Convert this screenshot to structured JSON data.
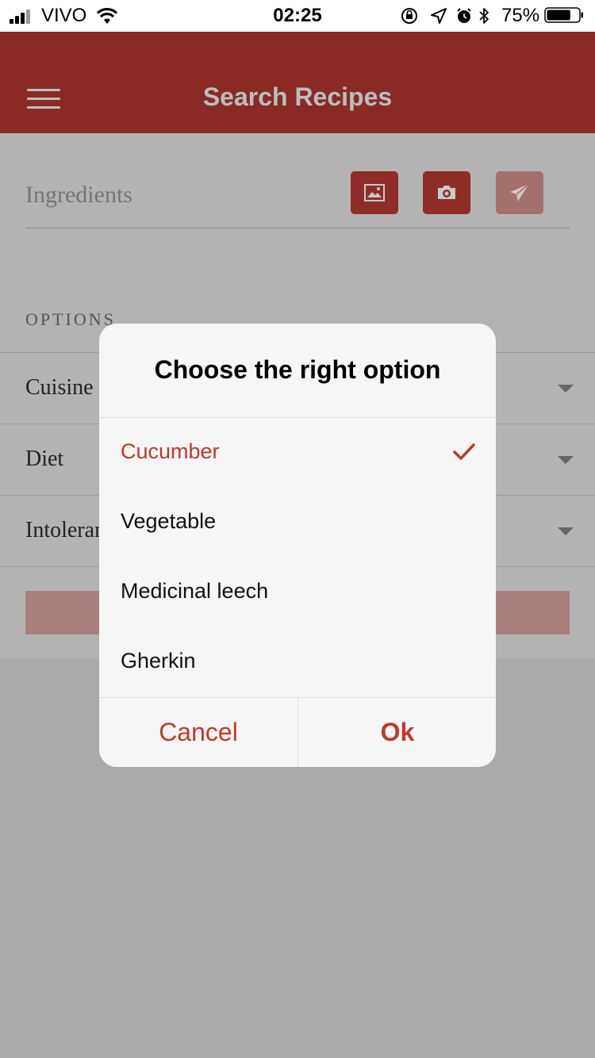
{
  "status_bar": {
    "carrier": "VIVO",
    "time": "02:25",
    "battery": "75%",
    "battery_level": 0.75
  },
  "header": {
    "title": "Search Recipes",
    "menu_icon": "hamburger-menu-icon"
  },
  "search": {
    "placeholder": "Ingredients",
    "tools": [
      {
        "name": "gallery-image-icon"
      },
      {
        "name": "camera-icon"
      },
      {
        "name": "send-paper-plane-icon"
      }
    ]
  },
  "options": {
    "heading": "OPTIONS",
    "rows": [
      {
        "label": "Cuisine"
      },
      {
        "label": "Diet"
      },
      {
        "label": "Intolerances"
      }
    ]
  },
  "dialog": {
    "title": "Choose the right option",
    "choices": [
      {
        "label": "Cucumber",
        "selected": true
      },
      {
        "label": "Vegetable",
        "selected": false
      },
      {
        "label": "Medicinal leech",
        "selected": false
      },
      {
        "label": "Gherkin",
        "selected": false
      }
    ],
    "cancel_label": "Cancel",
    "ok_label": "Ok"
  },
  "colors": {
    "brand": "#8a2a25",
    "accent": "#c0392b",
    "overlay_bg": "#aaaaaa"
  }
}
